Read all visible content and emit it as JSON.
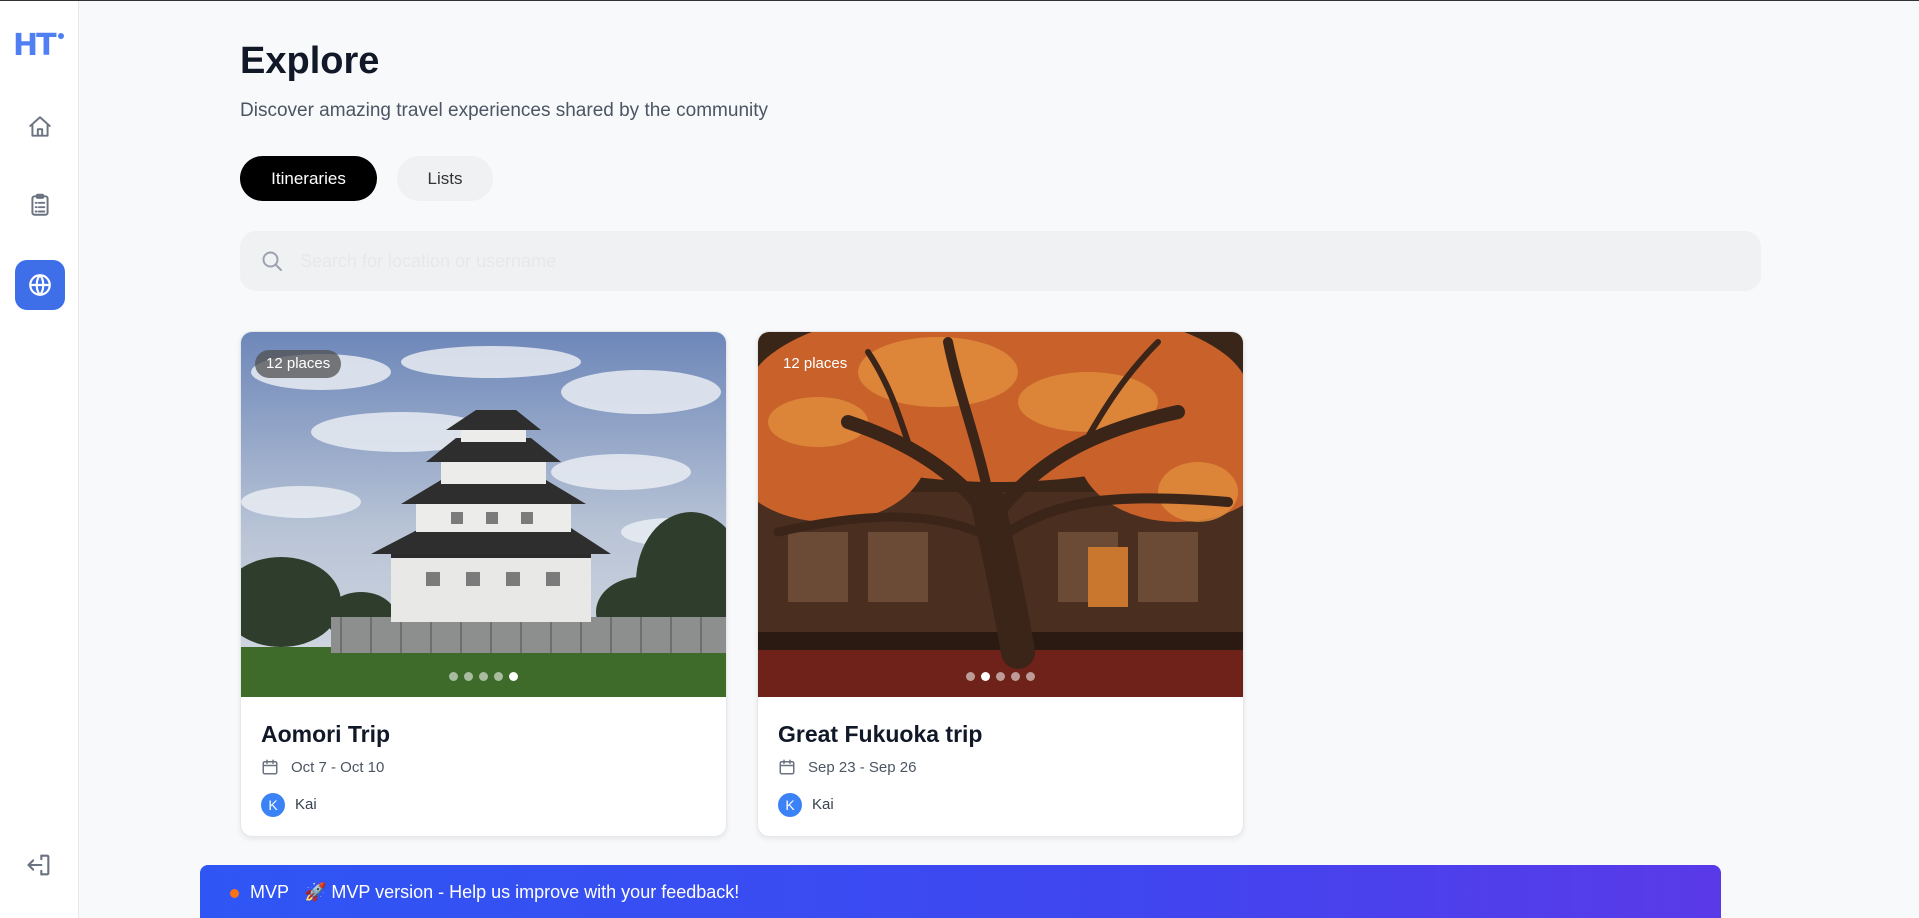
{
  "app": {
    "logo_text": "HT"
  },
  "sidebar": {
    "items": [
      {
        "name": "home",
        "icon": "home-icon"
      },
      {
        "name": "itineraries",
        "icon": "clipboard-icon"
      },
      {
        "name": "explore",
        "icon": "globe-icon",
        "active": true
      }
    ],
    "logout_icon": "logout-icon",
    "accent_color": "#3f6fe8"
  },
  "header": {
    "title": "Explore",
    "subtitle": "Discover amazing travel experiences shared by the community"
  },
  "tabs": [
    {
      "label": "Itineraries",
      "active": true
    },
    {
      "label": "Lists",
      "active": false
    }
  ],
  "search": {
    "placeholder": "Search for location or username",
    "value": ""
  },
  "cards": [
    {
      "title": "Aomori Trip",
      "places": "12 places",
      "dates": "Oct 7 - Oct 10",
      "author": "Kai",
      "author_initial": "K",
      "image": "castle-photo",
      "active_slide": 5,
      "slide_count": 5
    },
    {
      "title": "Great Fukuoka trip",
      "places": "12 places",
      "dates": "Sep 23 - Sep 26",
      "author": "Kai",
      "author_initial": "K",
      "image": "autumn-maple-tree-photo",
      "active_slide": 2,
      "slide_count": 5
    }
  ],
  "banner": {
    "tag": "MVP",
    "message": "🚀 MVP version - Help us improve with your feedback!",
    "dot_color": "#f97316"
  }
}
